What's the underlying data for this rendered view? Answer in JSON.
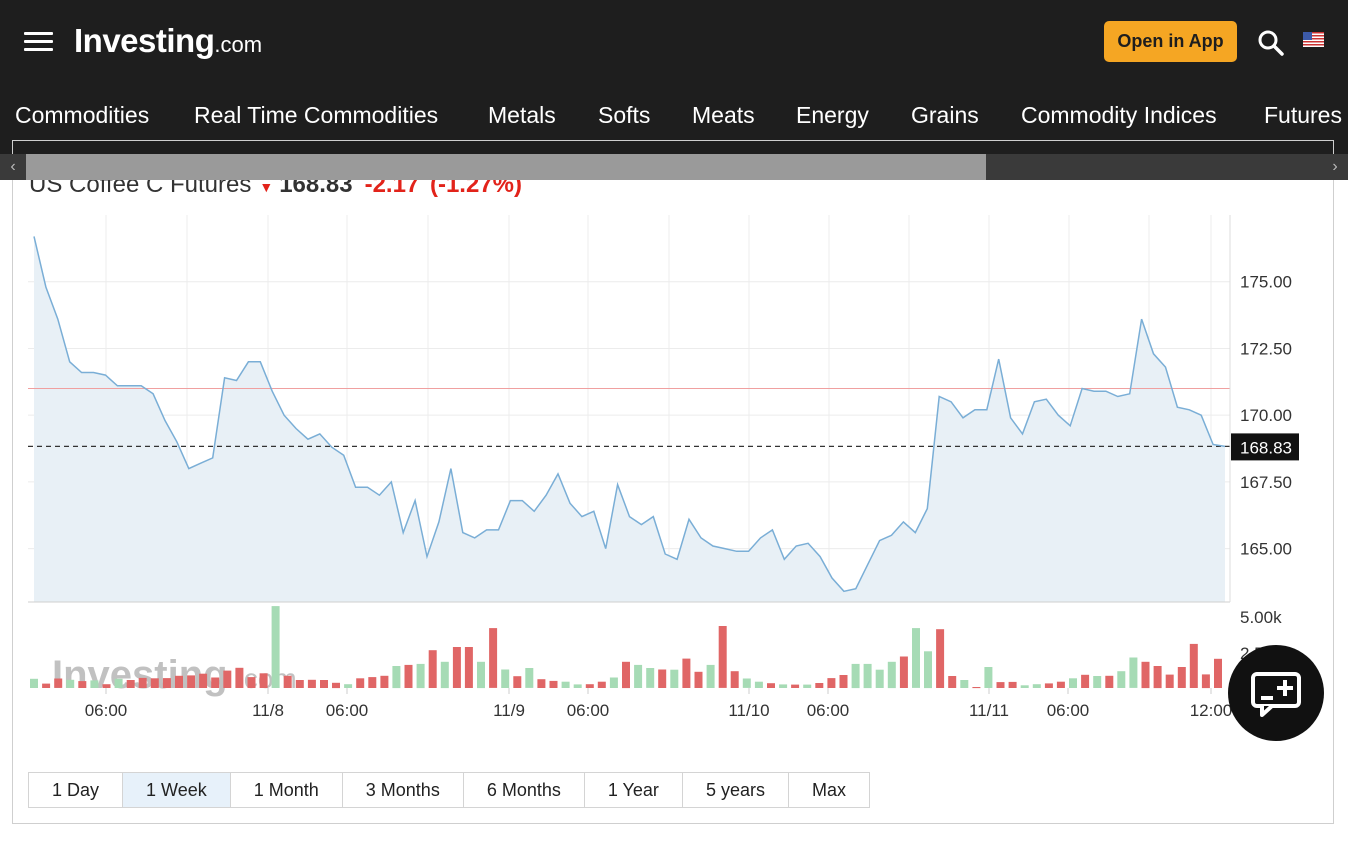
{
  "header": {
    "logo_brand": "Investing",
    "logo_domain": ".com",
    "open_app_label": "Open in App",
    "icons": [
      "hamburger-menu-icon",
      "search-icon",
      "us-flag-icon"
    ]
  },
  "nav": {
    "items": [
      "Commodities",
      "Real Time Commodities",
      "Metals",
      "Softs",
      "Meats",
      "Energy",
      "Grains",
      "Commodity Indices",
      "Futures"
    ]
  },
  "quote": {
    "name": "US Coffee C Futures",
    "price": "168.83",
    "change": "-2.17",
    "change_pct": "(-1.27%)"
  },
  "chart_data": {
    "type": "area",
    "ylim": [
      163,
      177.5
    ],
    "y_ticks": [
      "175.00",
      "172.50",
      "170.00",
      "167.50",
      "165.00"
    ],
    "current_value": 168.83,
    "current_label": "168.83",
    "previous_close": 171.0,
    "x_tick_labels": [
      "06:00",
      "11/8",
      "06:00",
      "11/9",
      "06:00",
      "11/10",
      "06:00",
      "11/11",
      "06:00",
      "12:00"
    ],
    "price_series": [
      176.7,
      174.8,
      173.6,
      172.0,
      171.6,
      171.6,
      171.5,
      171.1,
      171.1,
      171.1,
      170.8,
      169.8,
      169.0,
      168.0,
      168.2,
      168.4,
      171.4,
      171.3,
      172.0,
      172.0,
      170.9,
      170.0,
      169.5,
      169.1,
      169.3,
      168.8,
      168.5,
      167.3,
      167.3,
      167.0,
      167.5,
      165.6,
      166.8,
      164.7,
      166.0,
      168.0,
      165.6,
      165.4,
      165.7,
      165.7,
      166.8,
      166.8,
      166.4,
      167.0,
      167.8,
      166.7,
      166.2,
      166.4,
      165.0,
      167.4,
      166.2,
      165.9,
      166.2,
      164.8,
      164.6,
      166.1,
      165.4,
      165.1,
      165.0,
      164.9,
      164.9,
      165.4,
      165.7,
      164.6,
      165.1,
      165.2,
      164.7,
      163.9,
      163.4,
      163.5,
      164.4,
      165.3,
      165.5,
      166.0,
      165.6,
      166.5,
      170.7,
      170.5,
      169.9,
      170.2,
      170.2,
      172.1,
      169.9,
      169.3,
      170.5,
      170.6,
      170.0,
      169.6,
      171.0,
      170.9,
      170.9,
      170.7,
      170.8,
      173.6,
      172.3,
      171.8,
      170.3,
      170.2,
      170.0,
      168.9,
      168.83
    ],
    "volume_ymax": 5000,
    "volume_ticks": [
      "5.00k",
      "2.50k"
    ],
    "volume_series": [
      [
        440,
        "up"
      ],
      [
        210,
        "down"
      ],
      [
        450,
        "down"
      ],
      [
        390,
        "up"
      ],
      [
        330,
        "down"
      ],
      [
        360,
        "up"
      ],
      [
        180,
        "down"
      ],
      [
        440,
        "up"
      ],
      [
        380,
        "down"
      ],
      [
        480,
        "down"
      ],
      [
        460,
        "down"
      ],
      [
        470,
        "down"
      ],
      [
        580,
        "down"
      ],
      [
        600,
        "down"
      ],
      [
        680,
        "down"
      ],
      [
        500,
        "down"
      ],
      [
        830,
        "down"
      ],
      [
        960,
        "down"
      ],
      [
        520,
        "down"
      ],
      [
        700,
        "down"
      ],
      [
        3900,
        "up"
      ],
      [
        580,
        "down"
      ],
      [
        380,
        "down"
      ],
      [
        390,
        "down"
      ],
      [
        380,
        "down"
      ],
      [
        250,
        "down"
      ],
      [
        180,
        "up"
      ],
      [
        460,
        "down"
      ],
      [
        520,
        "down"
      ],
      [
        580,
        "down"
      ],
      [
        1050,
        "up"
      ],
      [
        1100,
        "down"
      ],
      [
        1150,
        "up"
      ],
      [
        1800,
        "down"
      ],
      [
        1250,
        "up"
      ],
      [
        1950,
        "down"
      ],
      [
        1950,
        "down"
      ],
      [
        1250,
        "up"
      ],
      [
        2850,
        "down"
      ],
      [
        880,
        "up"
      ],
      [
        560,
        "down"
      ],
      [
        950,
        "up"
      ],
      [
        420,
        "down"
      ],
      [
        340,
        "down"
      ],
      [
        300,
        "up"
      ],
      [
        170,
        "up"
      ],
      [
        180,
        "down"
      ],
      [
        300,
        "down"
      ],
      [
        500,
        "up"
      ],
      [
        1250,
        "down"
      ],
      [
        1100,
        "up"
      ],
      [
        950,
        "up"
      ],
      [
        880,
        "down"
      ],
      [
        870,
        "up"
      ],
      [
        1400,
        "down"
      ],
      [
        770,
        "down"
      ],
      [
        1100,
        "up"
      ],
      [
        2950,
        "down"
      ],
      [
        800,
        "down"
      ],
      [
        450,
        "up"
      ],
      [
        300,
        "up"
      ],
      [
        230,
        "down"
      ],
      [
        170,
        "up"
      ],
      [
        160,
        "down"
      ],
      [
        160,
        "up"
      ],
      [
        240,
        "down"
      ],
      [
        470,
        "down"
      ],
      [
        620,
        "down"
      ],
      [
        1150,
        "up"
      ],
      [
        1150,
        "up"
      ],
      [
        870,
        "up"
      ],
      [
        1250,
        "up"
      ],
      [
        1500,
        "down"
      ],
      [
        2850,
        "up"
      ],
      [
        1750,
        "up"
      ],
      [
        2800,
        "down"
      ],
      [
        570,
        "down"
      ],
      [
        380,
        "up"
      ],
      [
        50,
        "down"
      ],
      [
        1000,
        "up"
      ],
      [
        280,
        "down"
      ],
      [
        290,
        "down"
      ],
      [
        130,
        "up"
      ],
      [
        180,
        "up"
      ],
      [
        220,
        "down"
      ],
      [
        300,
        "down"
      ],
      [
        460,
        "up"
      ],
      [
        630,
        "down"
      ],
      [
        570,
        "up"
      ],
      [
        580,
        "down"
      ],
      [
        800,
        "up"
      ],
      [
        1450,
        "up"
      ],
      [
        1250,
        "down"
      ],
      [
        1050,
        "down"
      ],
      [
        640,
        "down"
      ],
      [
        1000,
        "down"
      ],
      [
        2100,
        "down"
      ],
      [
        650,
        "down"
      ],
      [
        1390,
        "down"
      ]
    ],
    "colors": {
      "line": "#7aaed6",
      "area": "#e8f0f6",
      "previous_close_line": "#f0a0a0",
      "volume_up": "#a6dbb5",
      "volume_down": "#e06666",
      "grid": "#ececec",
      "current_label_bg": "#111111"
    },
    "watermark": "Investing.com"
  },
  "ranges": {
    "items": [
      "1 Day",
      "1 Week",
      "1 Month",
      "3 Months",
      "6 Months",
      "1 Year",
      "5 years",
      "Max"
    ],
    "active": "1 Week"
  },
  "feedback": {
    "icon": "feedback-chat-plus-icon"
  },
  "colors": {
    "header_bg": "#1e1e1e",
    "accent": "#f5a623",
    "negative": "#e2231a"
  }
}
